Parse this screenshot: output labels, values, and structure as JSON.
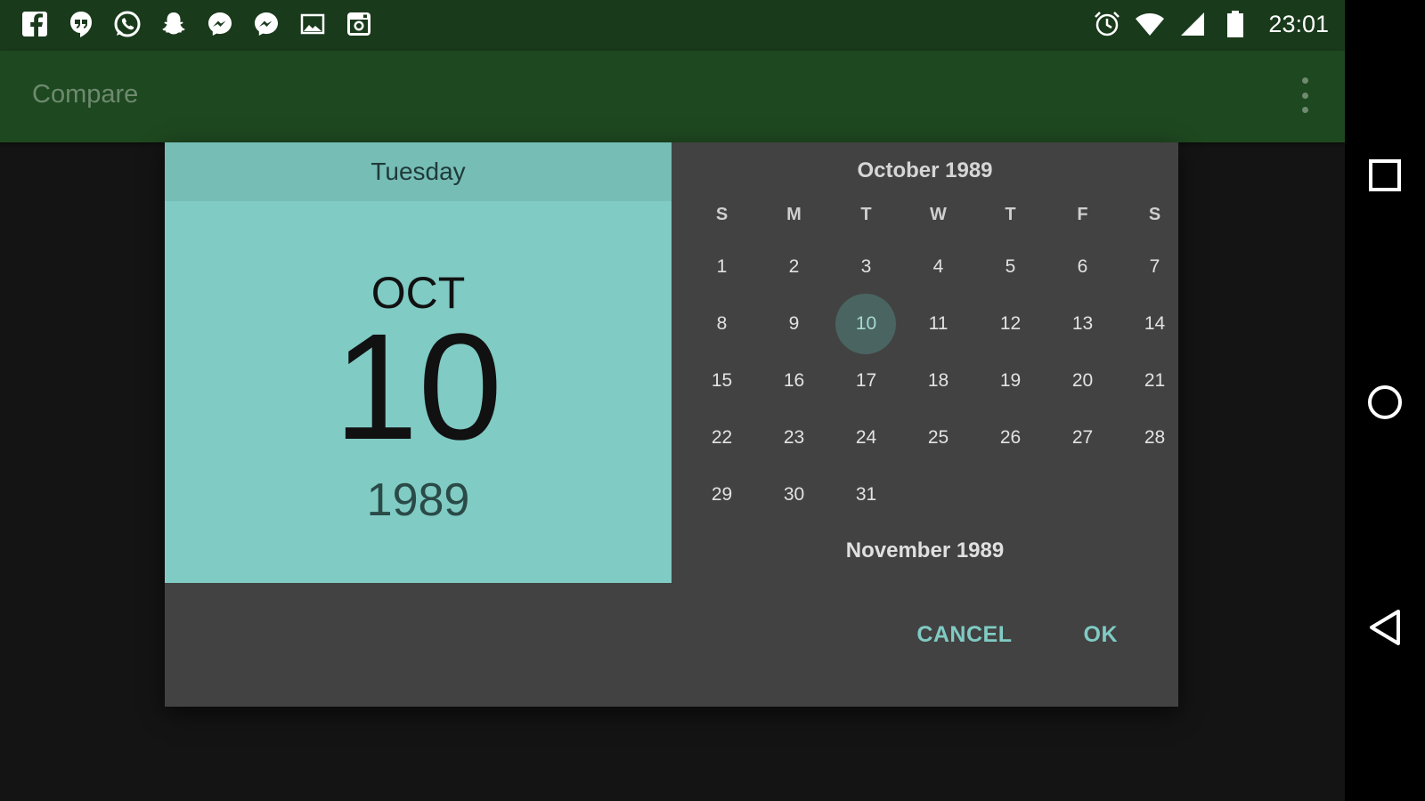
{
  "status_bar": {
    "time": "23:01",
    "left_icons": [
      "facebook-icon",
      "hangouts-icon",
      "whatsapp-icon",
      "snapchat-icon",
      "messenger-icon",
      "messenger-icon",
      "gallery-icon",
      "instagram-icon"
    ],
    "right_icons": [
      "alarm-icon",
      "wifi-icon",
      "signal-icon",
      "battery-icon"
    ]
  },
  "app_bar": {
    "title": "Compare"
  },
  "date_picker": {
    "header": {
      "weekday": "Tuesday",
      "month": "OCT",
      "day": "10",
      "year": "1989"
    },
    "calendar": {
      "month_title": "October 1989",
      "next_month_title": "November 1989",
      "weekdays": [
        "S",
        "M",
        "T",
        "W",
        "T",
        "F",
        "S"
      ],
      "weeks": [
        [
          "1",
          "2",
          "3",
          "4",
          "5",
          "6",
          "7"
        ],
        [
          "8",
          "9",
          "10",
          "11",
          "12",
          "13",
          "14"
        ],
        [
          "15",
          "16",
          "17",
          "18",
          "19",
          "20",
          "21"
        ],
        [
          "22",
          "23",
          "24",
          "25",
          "26",
          "27",
          "28"
        ],
        [
          "29",
          "30",
          "31",
          "",
          "",
          "",
          ""
        ]
      ],
      "selected_day": "10"
    },
    "actions": {
      "cancel": "CANCEL",
      "ok": "OK"
    }
  },
  "colors": {
    "status_bar": "#1a3a1c",
    "app_bar": "#1e4820",
    "header_bg": "#80cbc4",
    "dialog_bg": "#424242",
    "accent": "#80cbc4"
  }
}
